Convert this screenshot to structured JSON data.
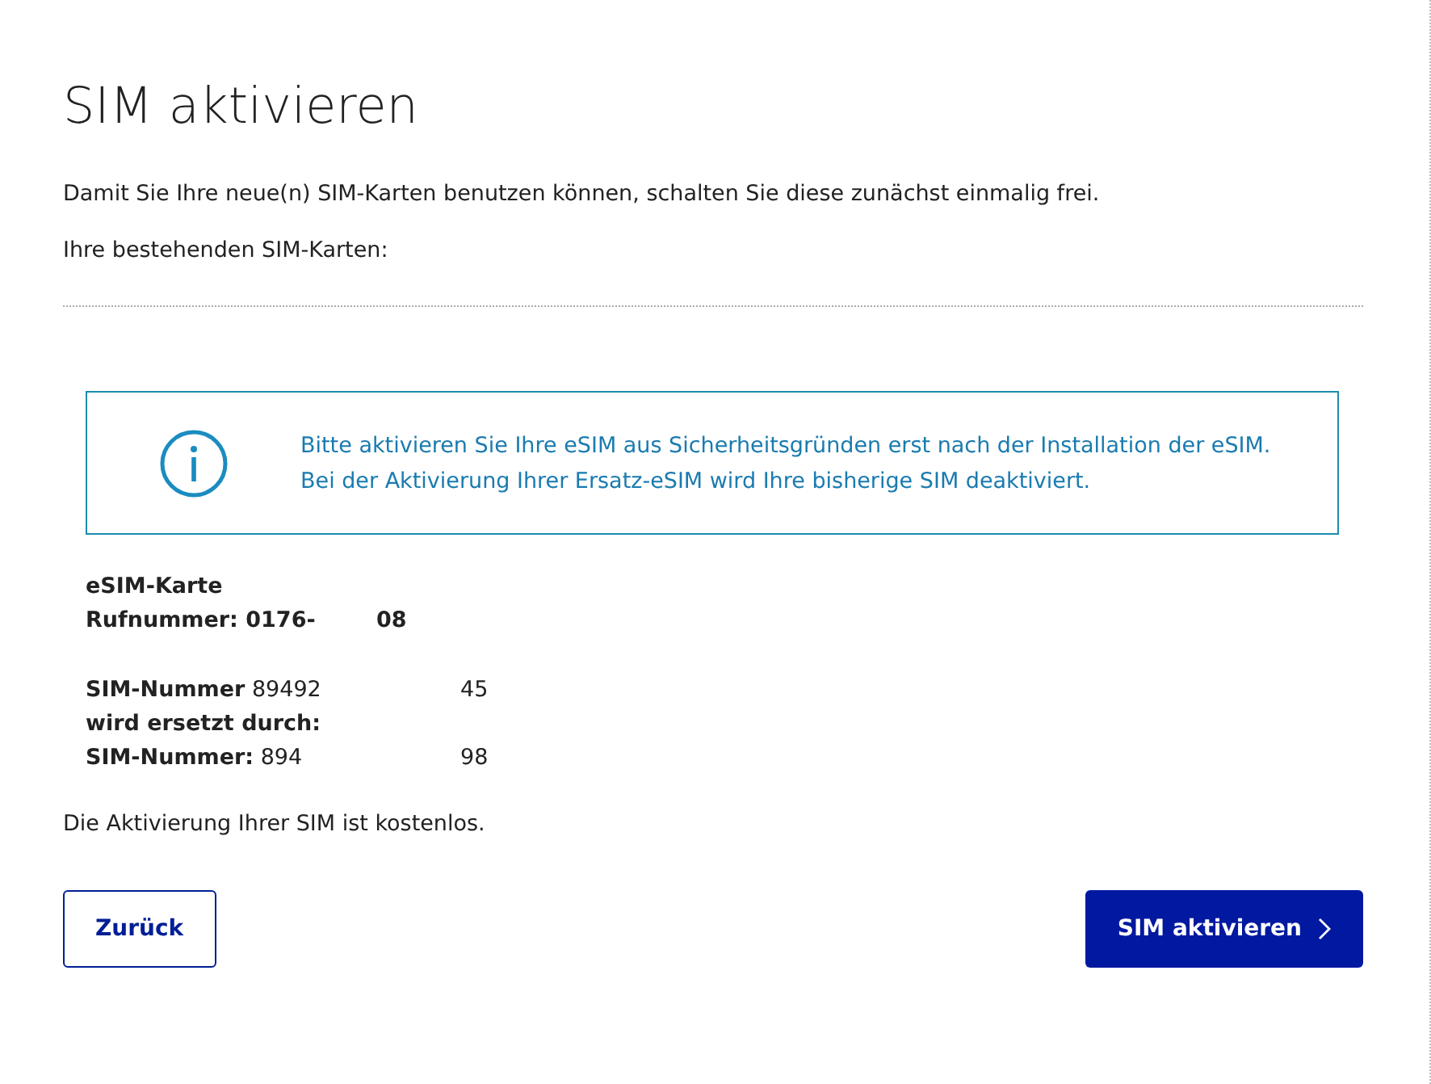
{
  "title": "SIM aktivieren",
  "intro": "Damit Sie Ihre neue(n) SIM-Karten benutzen können, schalten Sie diese zunächst einmalig frei.",
  "existing_label": "Ihre bestehenden SIM-Karten:",
  "info": "Bitte aktivieren Sie Ihre eSIM aus Sicherheitsgründen erst nach der Installation der eSIM. Bei der Aktivierung Ihrer Ersatz-eSIM wird Ihre bisherige SIM deaktiviert.",
  "card": {
    "type": "eSIM-Karte",
    "phone_label": "Rufnummer: 0176-",
    "phone_end": "08",
    "old_label": "SIM-Nummer",
    "old_start": "89492",
    "old_end": "45",
    "replaced_by": "wird ersetzt durch:",
    "new_label": "SIM-Nummer:",
    "new_start": "894",
    "new_end": "98"
  },
  "cost_note": "Die Aktivierung Ihrer SIM ist kostenlos.",
  "buttons": [
    {
      "label": "Zurück",
      "kind": "secondary"
    },
    {
      "label": "SIM aktivieren",
      "kind": "primary"
    }
  ]
}
